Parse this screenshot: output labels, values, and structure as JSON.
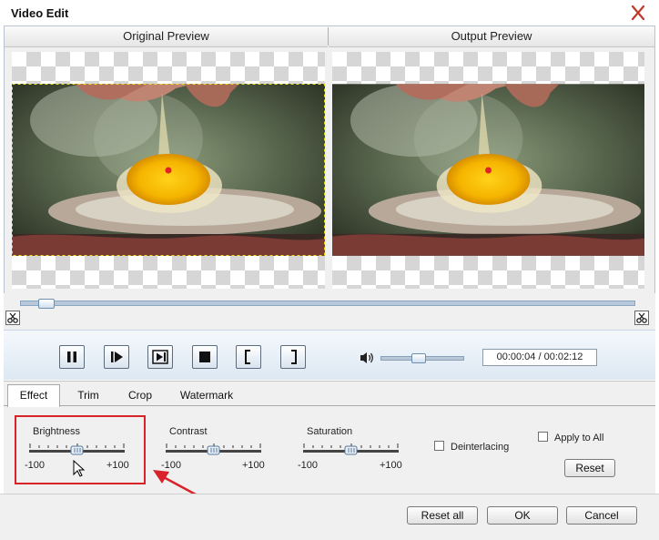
{
  "window": {
    "title": "Video Edit"
  },
  "preview": {
    "original_label": "Original Preview",
    "output_label": "Output Preview"
  },
  "playback": {
    "time_display": "00:00:04 / 00:02:12",
    "timeline_progress": 0.03,
    "volume_level": 0.45
  },
  "tabs": [
    {
      "label": "Effect",
      "active": true
    },
    {
      "label": "Trim",
      "active": false
    },
    {
      "label": "Crop",
      "active": false
    },
    {
      "label": "Watermark",
      "active": false
    }
  ],
  "effect": {
    "brightness": {
      "label": "Brightness",
      "min": "-100",
      "max": "+100",
      "value": 0
    },
    "contrast": {
      "label": "Contrast",
      "min": "-100",
      "max": "+100",
      "value": 0
    },
    "saturation": {
      "label": "Saturation",
      "min": "-100",
      "max": "+100",
      "value": 0
    },
    "deinterlacing": {
      "label": "Deinterlacing",
      "checked": false
    },
    "apply_to_all": {
      "label": "Apply to All",
      "checked": false
    },
    "reset_label": "Reset"
  },
  "footer": {
    "reset_all_label": "Reset all",
    "ok_label": "OK",
    "cancel_label": "Cancel"
  },
  "colors": {
    "accent": "#d9232a",
    "panel": "#f0f0f0",
    "control_border": "#5c6c7c"
  },
  "icons": [
    "close-icon",
    "pause-icon",
    "play-next-icon",
    "step-frame-icon",
    "stop-icon",
    "mark-in-icon",
    "mark-out-icon",
    "volume-icon",
    "scissor-icon",
    "cursor-icon",
    "arrow-annotation"
  ]
}
